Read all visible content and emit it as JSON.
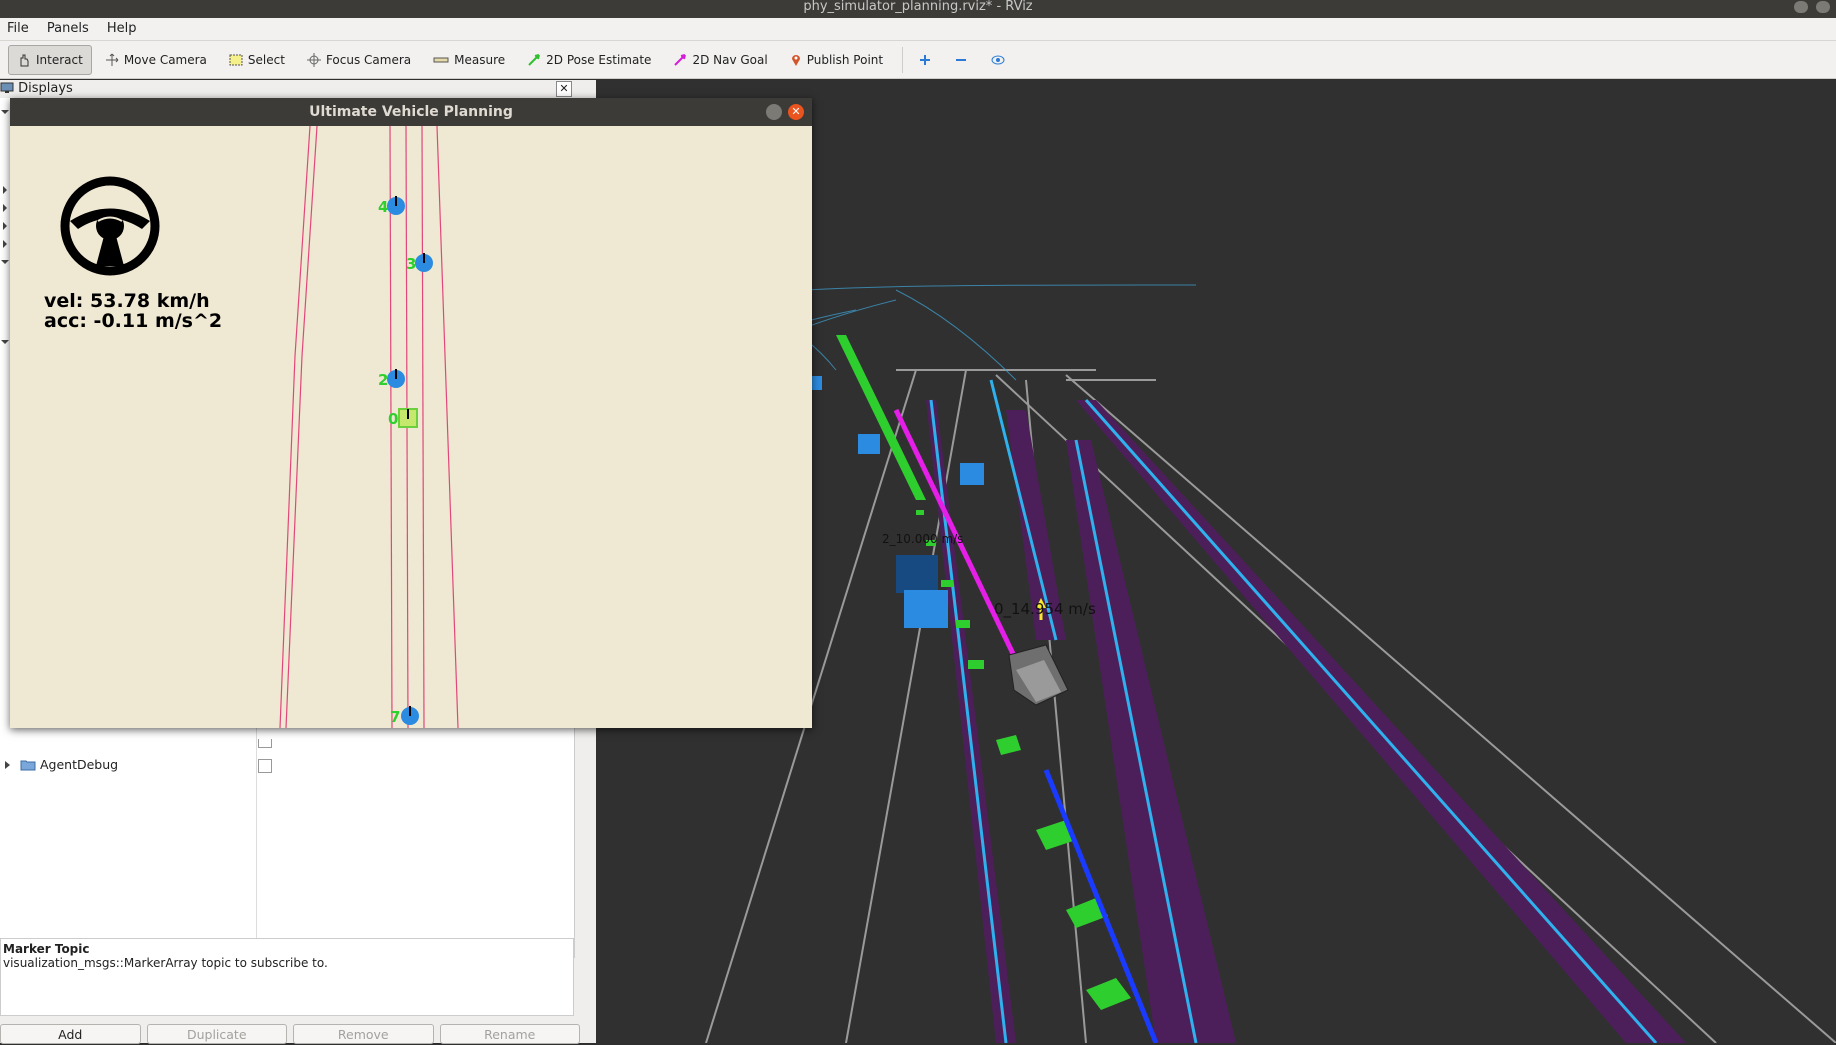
{
  "window": {
    "title": "phy_simulator_planning.rviz* - RViz"
  },
  "menu": {
    "file": "File",
    "panels": "Panels",
    "help": "Help"
  },
  "toolbar": {
    "interact": "Interact",
    "move_camera": "Move Camera",
    "select": "Select",
    "focus_camera": "Focus Camera",
    "measure": "Measure",
    "pose_estimate": "2D Pose Estimate",
    "nav_goal": "2D Nav Goal",
    "publish_point": "Publish Point"
  },
  "displays": {
    "title": "Displays",
    "close": "✕",
    "items": [
      {
        "label": "AgentDebug"
      }
    ]
  },
  "description": {
    "title": "Marker Topic",
    "text": "visualization_msgs::MarkerArray topic to subscribe to."
  },
  "buttons": {
    "add": "Add",
    "duplicate": "Duplicate",
    "remove": "Remove",
    "rename": "Rename"
  },
  "planning_window": {
    "title": "Ultimate Vehicle Planning",
    "vel": "vel: 53.78 km/h",
    "acc": "acc: -0.11 m/s^2",
    "agents": [
      {
        "id": "4"
      },
      {
        "id": "3"
      },
      {
        "id": "2"
      },
      {
        "id": "0"
      },
      {
        "id": "7"
      }
    ]
  },
  "viewport": {
    "labels": [
      {
        "text": "2_10.000  m/s"
      },
      {
        "text": "0_14.954  m/s"
      }
    ]
  },
  "colors": {
    "lane_blue": "#2fb1ee",
    "lane_purple": "#4d1f5a",
    "path_magenta": "#e51ee8",
    "marker_green": "#2fce2f",
    "agent_box": "#2b8be0"
  }
}
